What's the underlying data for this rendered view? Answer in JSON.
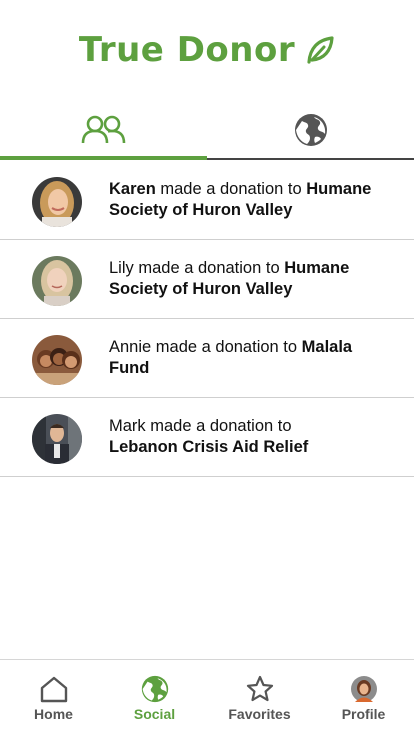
{
  "app": {
    "title": "True Donor",
    "accent": "#5da03f"
  },
  "tabs": [
    {
      "name": "social",
      "icon": "people-icon",
      "active": true
    },
    {
      "name": "global",
      "icon": "globe-icon",
      "active": false
    }
  ],
  "feed": [
    {
      "user": "Karen",
      "middle": " made a donation to ",
      "org": "Humane Society of Huron Valley",
      "user_bold": true
    },
    {
      "user": "Lily",
      "middle": " made a donation to ",
      "org": "Humane Society of Huron Valley",
      "user_bold": false
    },
    {
      "user": "Annie",
      "middle": " made a donation to ",
      "org": "Malala Fund",
      "user_bold": false
    },
    {
      "user": "Mark",
      "middle": " made a donation to ",
      "org": "Lebanon Crisis Aid Relief",
      "user_bold": false
    }
  ],
  "nav": {
    "home": "Home",
    "social": "Social",
    "favorites": "Favorites",
    "profile": "Profile",
    "active": "social"
  }
}
